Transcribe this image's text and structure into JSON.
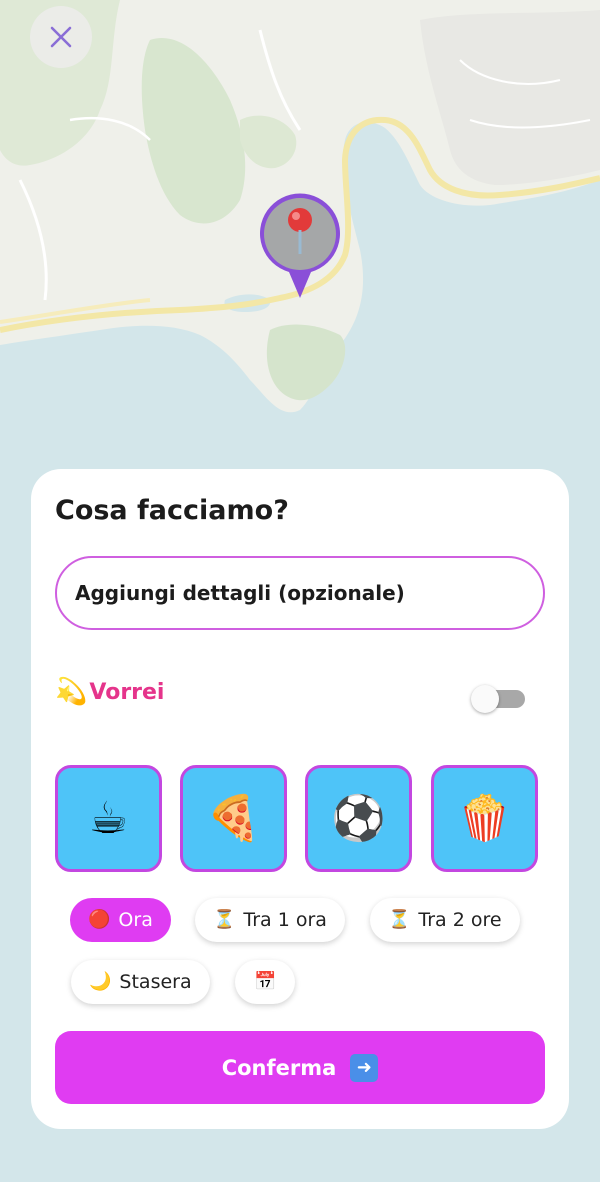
{
  "map": {
    "close_icon": "close-icon",
    "pin_icon": "location-pin-icon"
  },
  "sheet": {
    "title": "Cosa facciamo?",
    "details_text": "Aggiungi dettagli (opzionale)",
    "wish": {
      "emoji": "💫",
      "label": "Vorrei",
      "toggle_on": false
    },
    "activities": [
      {
        "emoji": "☕",
        "name": "coffee"
      },
      {
        "emoji": "🍕",
        "name": "pizza"
      },
      {
        "emoji": "⚽",
        "name": "soccer"
      },
      {
        "emoji": "🍿",
        "name": "popcorn"
      }
    ],
    "time_chips": [
      {
        "icon": "🔴",
        "label": "Ora",
        "selected": true
      },
      {
        "icon": "⏳",
        "label": "Tra 1 ora",
        "selected": false
      },
      {
        "icon": "⏳",
        "label": "Tra 2 ore",
        "selected": false
      },
      {
        "icon": "🌙",
        "label": "Stasera",
        "selected": false
      },
      {
        "icon": "📅",
        "label": "",
        "selected": false
      }
    ],
    "confirm_label": "Conferma",
    "confirm_icon": "➡️"
  },
  "colors": {
    "accent": "#e03cf2",
    "activity_tile": "#4ec4f8",
    "wish_label": "#e5348b",
    "pin_ring": "#8a4fd8"
  }
}
